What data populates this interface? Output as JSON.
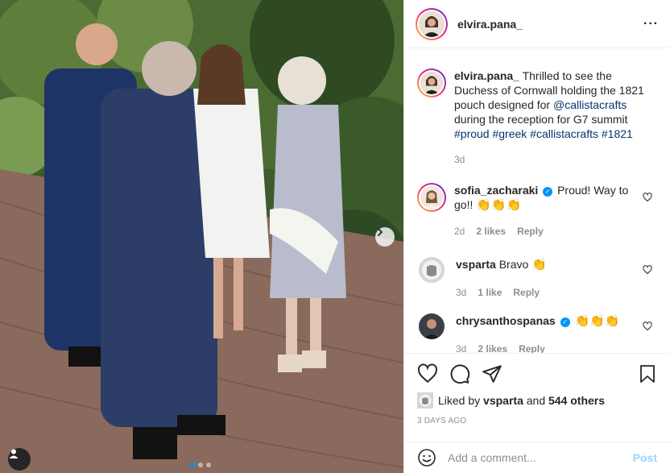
{
  "post": {
    "username": "elvira.pana_",
    "caption_text": "Thrilled to see the Duchess of Cornwall holding the 1821 pouch designed for",
    "caption_mention": "@callistacrafts",
    "caption_text2": "during the reception for G7 summit",
    "hashtags": "#proud #greek #callistacrafts #1821",
    "caption_age": "3d"
  },
  "comments": [
    {
      "username": "sofia_zacharaki",
      "verified": true,
      "text": "Proud! Way to go!!",
      "emoji": "👏👏👏",
      "age": "2d",
      "likes": "2 likes",
      "reply": "Reply"
    },
    {
      "username": "vsparta",
      "verified": false,
      "text": "Bravo",
      "emoji": "👏",
      "age": "3d",
      "likes": "1 like",
      "reply": "Reply"
    },
    {
      "username": "chrysanthospanas",
      "verified": true,
      "text": "",
      "emoji": "👏👏👏",
      "age": "3d",
      "likes": "2 likes",
      "reply": "Reply"
    }
  ],
  "likes": {
    "prefix": "Liked by",
    "user": "vsparta",
    "and": "and",
    "others": "544 others"
  },
  "timestamp": "3 DAYS AGO",
  "add_comment": {
    "placeholder": "Add a comment...",
    "post_label": "Post"
  },
  "colors": {
    "accent": "#0095f6",
    "link": "#00376b",
    "muted": "#8e8e8e"
  }
}
